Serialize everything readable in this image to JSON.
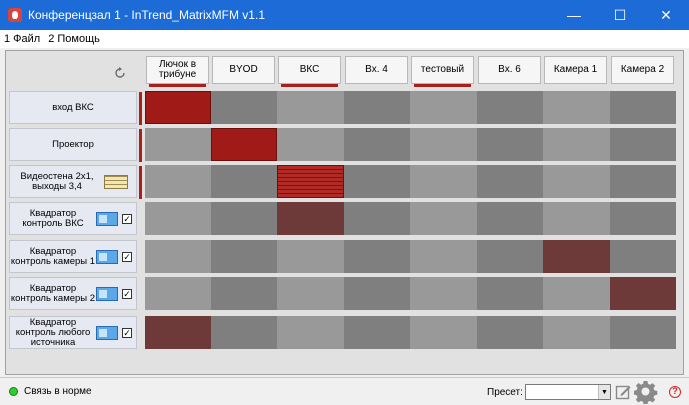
{
  "window": {
    "title": "Конференцзал 1 - InTrend_MatrixMFM v1.1",
    "app_icon": "shield-logo-icon",
    "controls": {
      "minimize": "—",
      "maximize": "☐",
      "close": "✕"
    }
  },
  "menu": [
    "1 Файл",
    "2 Помощь"
  ],
  "matrix": {
    "columns": [
      {
        "label": "Лючок в трибуне",
        "active": true
      },
      {
        "label": "BYOD",
        "active": false
      },
      {
        "label": "ВКС",
        "active": true
      },
      {
        "label": "Вх. 4",
        "active": false
      },
      {
        "label": "тестовый",
        "active": true
      },
      {
        "label": "Вх. 6",
        "active": false
      },
      {
        "label": "Камера 1",
        "active": false
      },
      {
        "label": "Камера 2",
        "active": false
      }
    ],
    "rows": [
      {
        "label": "вход ВКС",
        "icon": "",
        "checked": null,
        "active": true
      },
      {
        "label": "Проектор",
        "icon": "",
        "checked": null,
        "active": true
      },
      {
        "label": "Видеостена 2x1, выходы 3,4",
        "icon": "video-wall-icon",
        "checked": null,
        "active": true
      },
      {
        "label": "Квадратор контроль ВКС",
        "icon": "monitor-icon",
        "checked": true,
        "active": false
      },
      {
        "label": "Квадратор контроль камеры 1",
        "icon": "monitor-icon",
        "checked": true,
        "active": false
      },
      {
        "label": "Квадратор контроль камеры 2",
        "icon": "monitor-icon",
        "checked": true,
        "active": false
      },
      {
        "label": "Квадратор контроль любого источника",
        "icon": "monitor-icon",
        "checked": true,
        "active": false
      }
    ],
    "routes": [
      {
        "row": 0,
        "col": 0,
        "style": "red"
      },
      {
        "row": 1,
        "col": 1,
        "style": "red"
      },
      {
        "row": 2,
        "col": 2,
        "style": "brick"
      },
      {
        "row": 3,
        "col": 2,
        "style": "maroon"
      },
      {
        "row": 4,
        "col": 6,
        "style": "maroon"
      },
      {
        "row": 5,
        "col": 7,
        "style": "maroon"
      },
      {
        "row": 6,
        "col": 0,
        "style": "maroon"
      }
    ],
    "colors": {
      "active_bar": "#a8201b",
      "cell_dark": "#7f7f7f",
      "cell_light": "#999999",
      "route_red": "#a01a18",
      "route_maroon": "#6e3a39"
    }
  },
  "status": {
    "connection_text": "Связь в норме",
    "connection_color": "#2fcf2f",
    "preset_label": "Пресет:",
    "preset_value": ""
  }
}
